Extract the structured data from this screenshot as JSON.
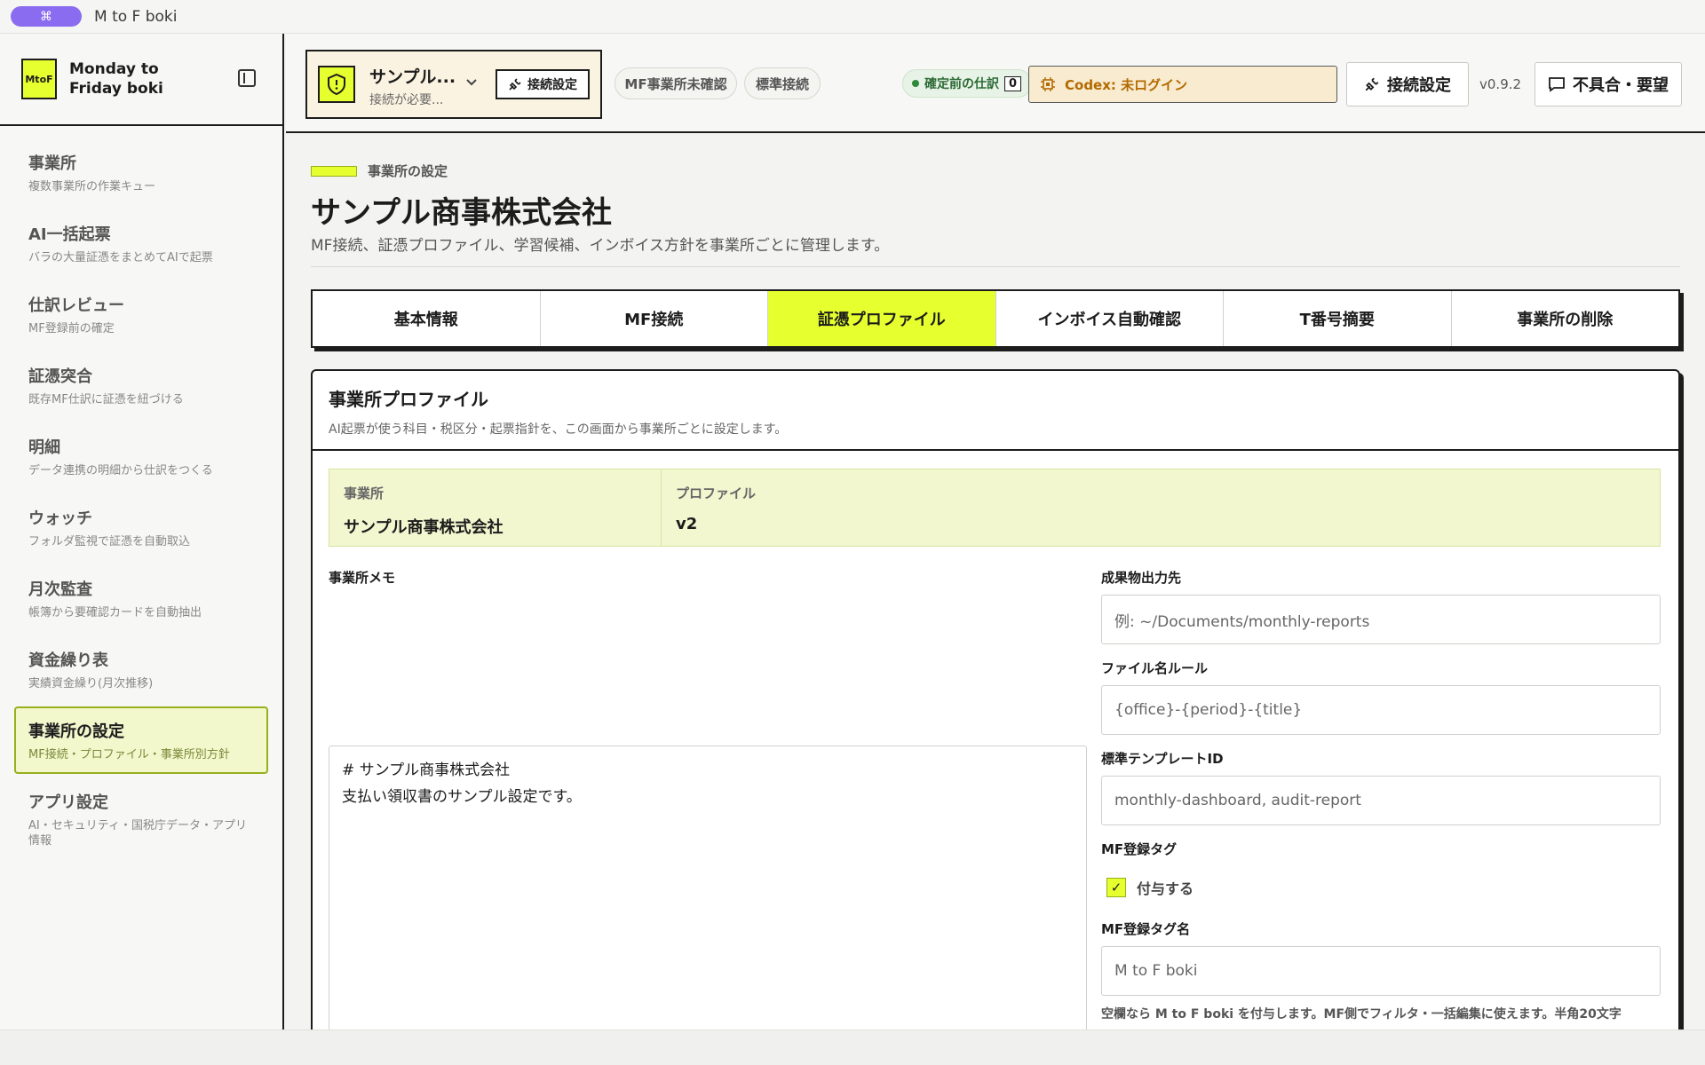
{
  "titlebar": {
    "cmd_icon": "⌘",
    "title": "M to F boki"
  },
  "sidebar": {
    "logo": "MtoF",
    "brand": "Monday to Friday boki",
    "items": [
      {
        "label": "事業所",
        "sub": "複数事業所の作業キュー"
      },
      {
        "label": "AI一括起票",
        "sub": "バラの大量証憑をまとめてAIで起票"
      },
      {
        "label": "仕訳レビュー",
        "sub": "MF登録前の確定"
      },
      {
        "label": "証憑突合",
        "sub": "既存MF仕訳に証憑を紐づける"
      },
      {
        "label": "明細",
        "sub": "データ連携の明細から仕訳をつくる"
      },
      {
        "label": "ウォッチ",
        "sub": "フォルダ監視で証憑を自動取込"
      },
      {
        "label": "月次監査",
        "sub": "帳簿から要確認カードを自動抽出"
      },
      {
        "label": "資金繰り表",
        "sub": "実績資金繰り(月次推移)"
      },
      {
        "label": "事業所の設定",
        "sub": "MF接続・プロファイル・事業所別方針"
      },
      {
        "label": "アプリ設定",
        "sub": "AI・セキュリティ・国税庁データ・アプリ情報"
      }
    ]
  },
  "header": {
    "office_name": "サンプル...",
    "office_status": "接続が必要...",
    "connect_small": "接続設定",
    "chip_mf": "MF事業所未確認",
    "chip_std": "標準接続",
    "pending_label": "確定前の仕訳",
    "pending_count": "0",
    "codex": "Codex: 未ログイン",
    "connect_button": "接続設定",
    "version": "v0.9.2",
    "feedback_button": "不具合・要望"
  },
  "main": {
    "eyebrow": "事業所の設定",
    "title": "サンプル商事株式会社",
    "description": "MF接続、証憑プロファイル、学習候補、インボイス方針を事業所ごとに管理します。",
    "tabs": [
      "基本情報",
      "MF接続",
      "証憑プロファイル",
      "インボイス自動確認",
      "T番号摘要",
      "事業所の削除"
    ],
    "active_tab": 2,
    "panel": {
      "title": "事業所プロファイル",
      "subtitle": "AI起票が使う科目・税区分・起票指針を、この画面から事業所ごとに設定します。",
      "office_key": "事業所",
      "office_value": "サンプル商事株式会社",
      "profile_key": "プロファイル",
      "profile_value": "v2",
      "memo_label": "事業所メモ",
      "memo_text": "# サンプル商事株式会社\n支払い領収書のサンプル設定です。",
      "output_label": "成果物出力先",
      "output_placeholder": "例: ~/Documents/monthly-reports",
      "filename_label": "ファイル名ルール",
      "filename_value": "{office}-{period}-{title}",
      "template_label": "標準テンプレートID",
      "template_value": "monthly-dashboard, audit-report",
      "tag_label": "MF登録タグ",
      "tag_check_label": "付与する",
      "tag_name_label": "MF登録タグ名",
      "tag_name_value": "M to F boki",
      "help_text": "空欄なら M to F boki を付与します。MF側でフィルタ・一括編集に使えます。半角20文字"
    }
  },
  "colors": {
    "accent": "#e6ff2e",
    "border": "#1c1c1c",
    "active_nav": "#f2f7cc"
  }
}
